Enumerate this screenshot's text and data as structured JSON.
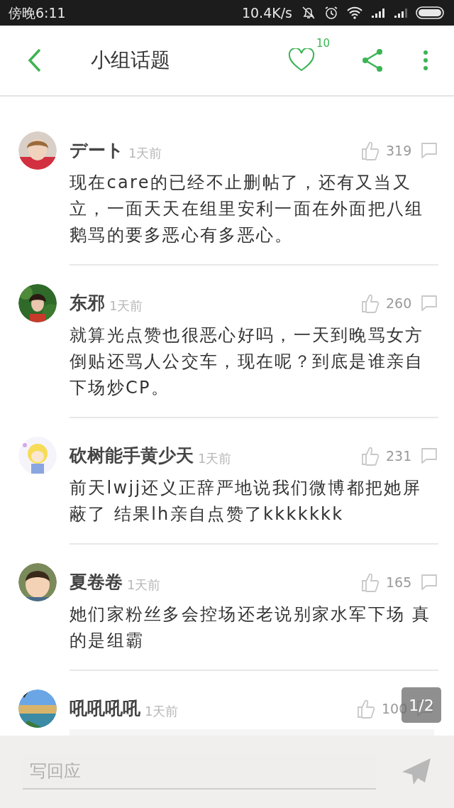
{
  "status_bar": {
    "time": "傍晚6:11",
    "speed": "10.4K/s"
  },
  "header": {
    "title": "小组话题",
    "like_count": "10"
  },
  "comments": [
    {
      "name": "デート",
      "time": "1天前",
      "likes": "319",
      "text": "现在care的已经不止删帖了，还有又当又立，一面天天在组里安利一面在外面把八组鹅骂的要多恶心有多恶心。"
    },
    {
      "name": "东邪",
      "time": "1天前",
      "likes": "260",
      "text": "就算光点赞也很恶心好吗，一天到晚骂女方倒贴还骂人公交车，现在呢？到底是谁亲自下场炒CP。"
    },
    {
      "name": "砍树能手黄少天",
      "time": "1天前",
      "likes": "231",
      "text": "前天lwjj还义正辞严地说我们微博都把她屏蔽了 结果lh亲自点赞了kkkkkkk"
    },
    {
      "name": "夏卷卷",
      "time": "1天前",
      "likes": "165",
      "text": "她们家粉丝多会控场还老说别家水军下场 真的是组霸"
    },
    {
      "name": "吼吼吼吼",
      "time": "1天前",
      "likes": "100",
      "quote": true
    }
  ],
  "page_indicator": "1/2",
  "reply": {
    "placeholder": "写回应"
  }
}
